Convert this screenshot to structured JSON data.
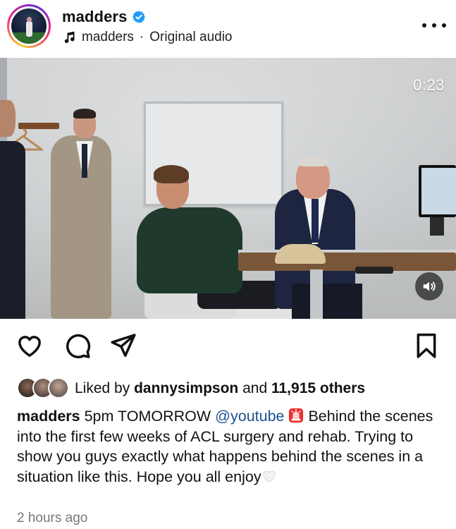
{
  "post": {
    "username": "madders",
    "verified": true,
    "audio": {
      "artist": "madders",
      "separator": "·",
      "title": "Original audio"
    },
    "more_icon": "more-horizontal-icon"
  },
  "video": {
    "timer": "0:23",
    "sound_icon": "speaker-on-icon"
  },
  "actions": {
    "like_icon": "heart-icon",
    "comment_icon": "comment-bubble-icon",
    "share_icon": "paper-plane-icon",
    "save_icon": "bookmark-icon"
  },
  "likes": {
    "prefix": "Liked by ",
    "user": "dannysimpson",
    "conjunction": " and ",
    "count": "11,915 others"
  },
  "caption": {
    "username": "madders",
    "part1": " 5pm TOMORROW ",
    "mention": "@youtube",
    "emoji1": "siren-emoji",
    "part2": " Behind the scenes into the first few weeks of ACL surgery and rehab. Trying to show you guys exactly what happens behind the scenes in a situation like this. Hope you all enjoy",
    "emoji2": "white-heart-emoji"
  },
  "timestamp": "2 hours ago",
  "colors": {
    "verified_blue": "#1d9bf0",
    "mention_blue": "#1f4f8f",
    "timestamp_gray": "#777777"
  }
}
